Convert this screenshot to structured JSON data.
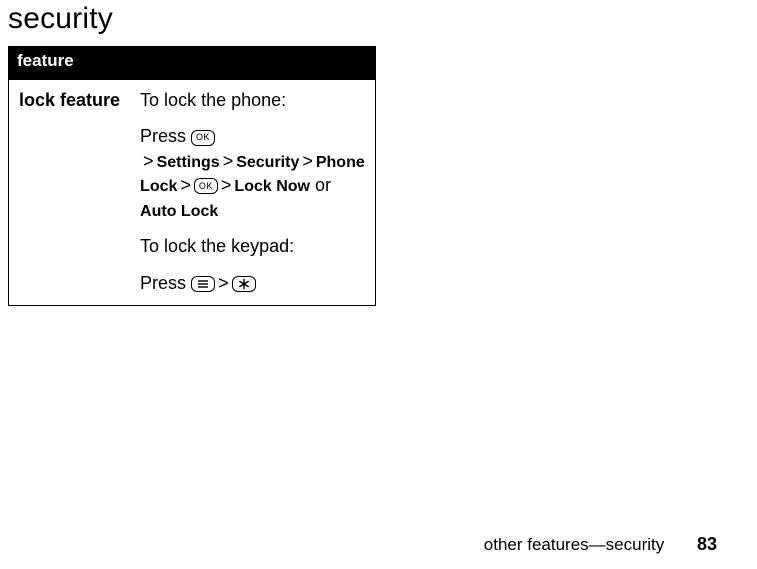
{
  "title": "security",
  "table": {
    "header": "feature",
    "row": {
      "label": "lock feature",
      "p1": "To lock the phone:",
      "p2_press": "Press ",
      "p2_settings": "Settings",
      "p2_security": "Security",
      "p2_phonelock": "Phone Lock",
      "p2_locknow": "Lock Now",
      "p2_or": " or ",
      "p2_autolock": "Auto Lock",
      "p3": "To lock the keypad:",
      "p4_press": "Press "
    }
  },
  "keys": {
    "ok": "OK"
  },
  "sep": ">",
  "footer": {
    "text": "other features—security",
    "page": "83"
  }
}
